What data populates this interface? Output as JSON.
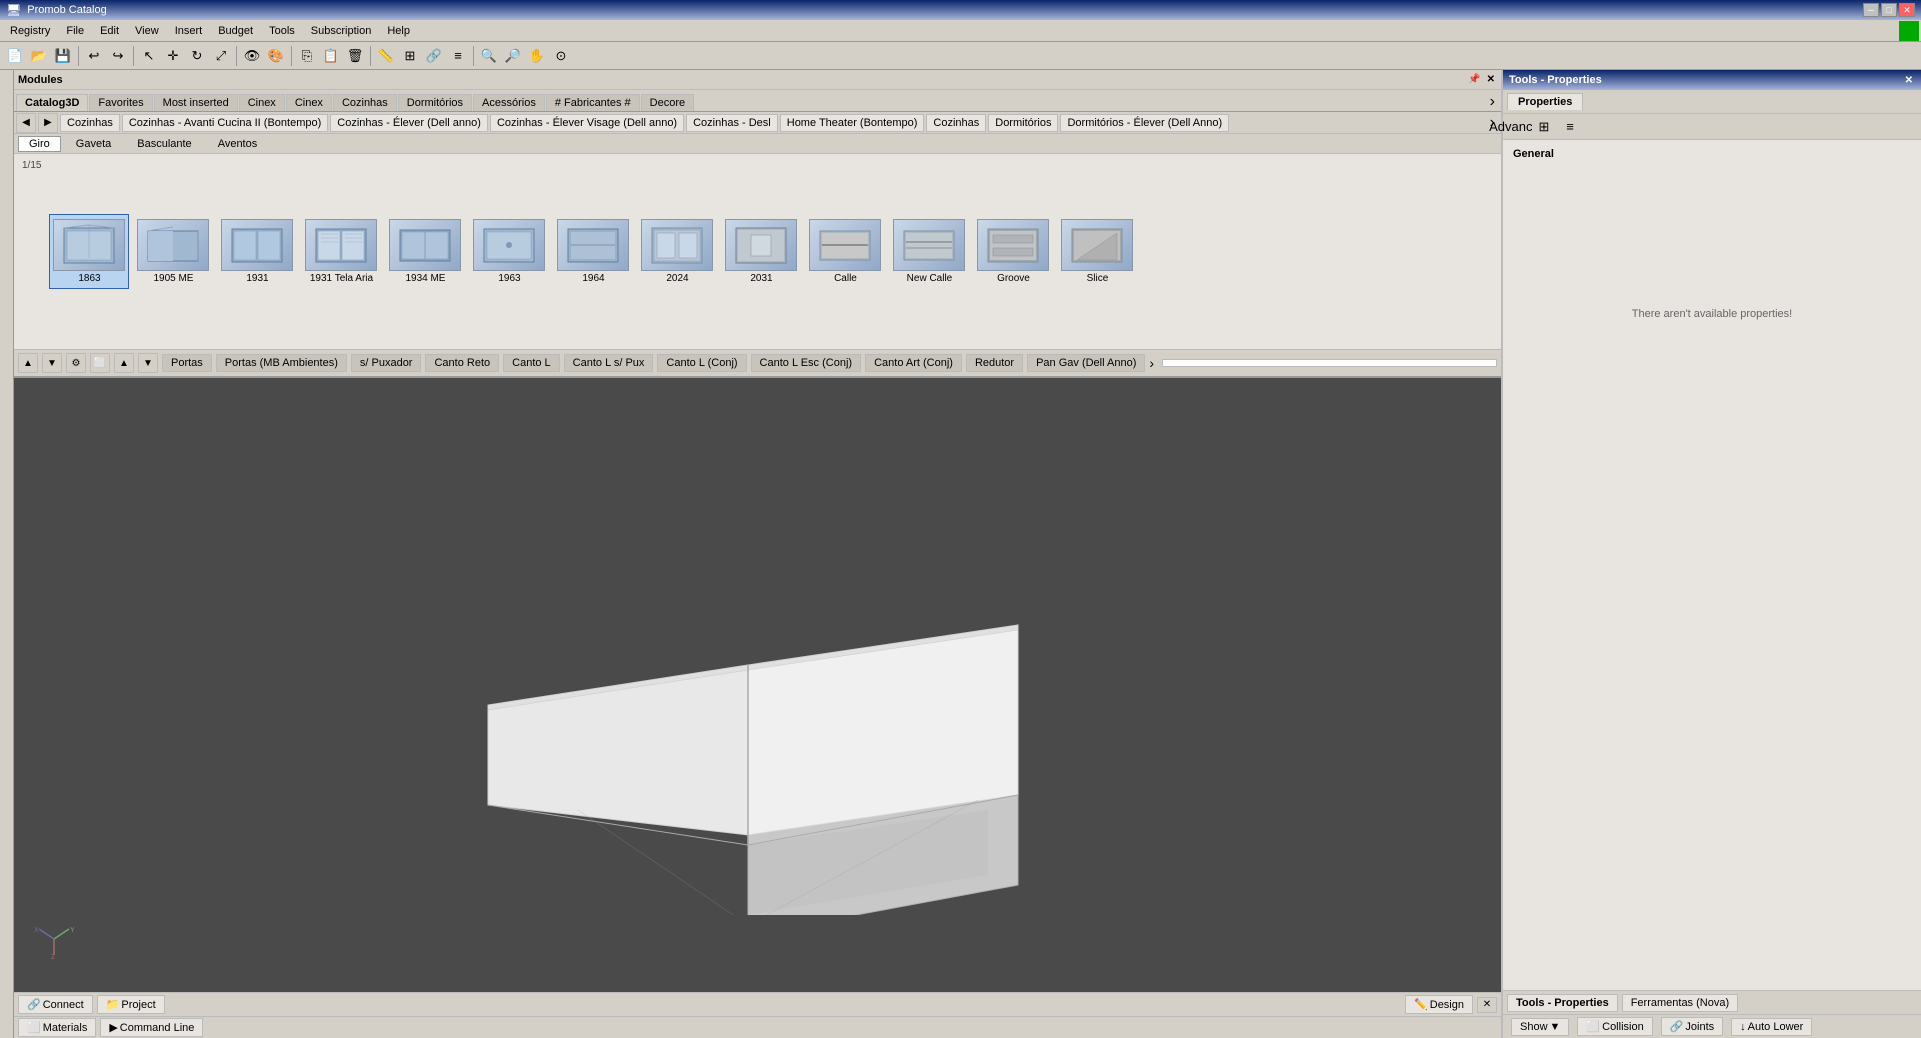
{
  "titlebar": {
    "title": "Promob Catalog",
    "min_btn": "─",
    "max_btn": "□",
    "close_btn": "✕"
  },
  "menubar": {
    "items": [
      "Registry",
      "File",
      "Edit",
      "View",
      "Insert",
      "Budget",
      "Tools",
      "Subscription",
      "Help"
    ]
  },
  "modules": {
    "header": "Modules",
    "pin": "📌"
  },
  "catalog_tabs": [
    {
      "label": "Catalog3D",
      "active": false
    },
    {
      "label": "Favorites",
      "active": false
    },
    {
      "label": "Most inserted",
      "active": false
    },
    {
      "label": "Cinex",
      "active": false
    },
    {
      "label": "Cinex",
      "active": false
    },
    {
      "label": "Cozinhas",
      "active": false
    },
    {
      "label": "Dormitórios",
      "active": false
    },
    {
      "label": "Acessórios",
      "active": false
    },
    {
      "label": "# Fabricantes #",
      "active": false
    },
    {
      "label": "Decore",
      "active": false
    }
  ],
  "breadcrumb": {
    "items": [
      "Cozinhas",
      "Cozinhas - Avanti Cucina II (Bontempo)",
      "Cozinhas - Élever (Dell anno)",
      "Cozinhas - Élever Visage (Dell anno)",
      "Cozinhas - Desl",
      "Home Theater (Bontempo)",
      "Cozinhas",
      "Dormitórios",
      "Dormitórios - Élever (Dell Anno)"
    ]
  },
  "sub_tabs": {
    "items": [
      "Giro",
      "Gaveta",
      "Basculante",
      "Aventos"
    ],
    "active": "Giro"
  },
  "page_indicator": "1/15",
  "items": [
    {
      "label": "1863"
    },
    {
      "label": "1905 ME"
    },
    {
      "label": "1931"
    },
    {
      "label": "1931 Tela Aria"
    },
    {
      "label": "1934 ME"
    },
    {
      "label": "1963"
    },
    {
      "label": "1964"
    },
    {
      "label": "2024"
    },
    {
      "label": "2031"
    },
    {
      "label": "Calle"
    },
    {
      "label": "New Calle"
    },
    {
      "label": "Groove"
    },
    {
      "label": "Slice"
    }
  ],
  "doors_toolbar": {
    "items": [
      "Portas",
      "Portas (MB Ambientes)",
      "s/ Puxador",
      "Canto Reto",
      "Canto L",
      "Canto L s/ Pux",
      "Canto L (Conj)",
      "Canto L Esc (Conj)",
      "Canto Art (Conj)",
      "Redutor",
      "Pan Gav (Dell Anno)"
    ]
  },
  "right_panel": {
    "header": "Tools - Properties",
    "close_btn": "✕",
    "tabs": [
      "Properties"
    ],
    "toolbar_items": [
      "Advanced"
    ],
    "section": "General",
    "no_props_msg": "There aren't available properties!"
  },
  "bottom_tabs": {
    "left": [
      {
        "label": "Connect",
        "icon": "🔗"
      },
      {
        "label": "Project",
        "icon": "📁"
      }
    ],
    "center": {
      "label": "Design",
      "icon": "✏️"
    },
    "right": []
  },
  "bottom_panels": [
    {
      "label": "Materials",
      "icon": "⬜"
    },
    {
      "label": "Command Line",
      "icon": ">"
    }
  ],
  "right_panel_bottom": [
    {
      "label": "Tools - Properties",
      "active": true
    },
    {
      "label": "Ferramentas (Nova)",
      "active": false
    }
  ],
  "bottom_right_status": {
    "show_label": "Show",
    "collision_label": "Collision",
    "joints_label": "Joints",
    "auto_lower_label": "Auto Lower"
  }
}
